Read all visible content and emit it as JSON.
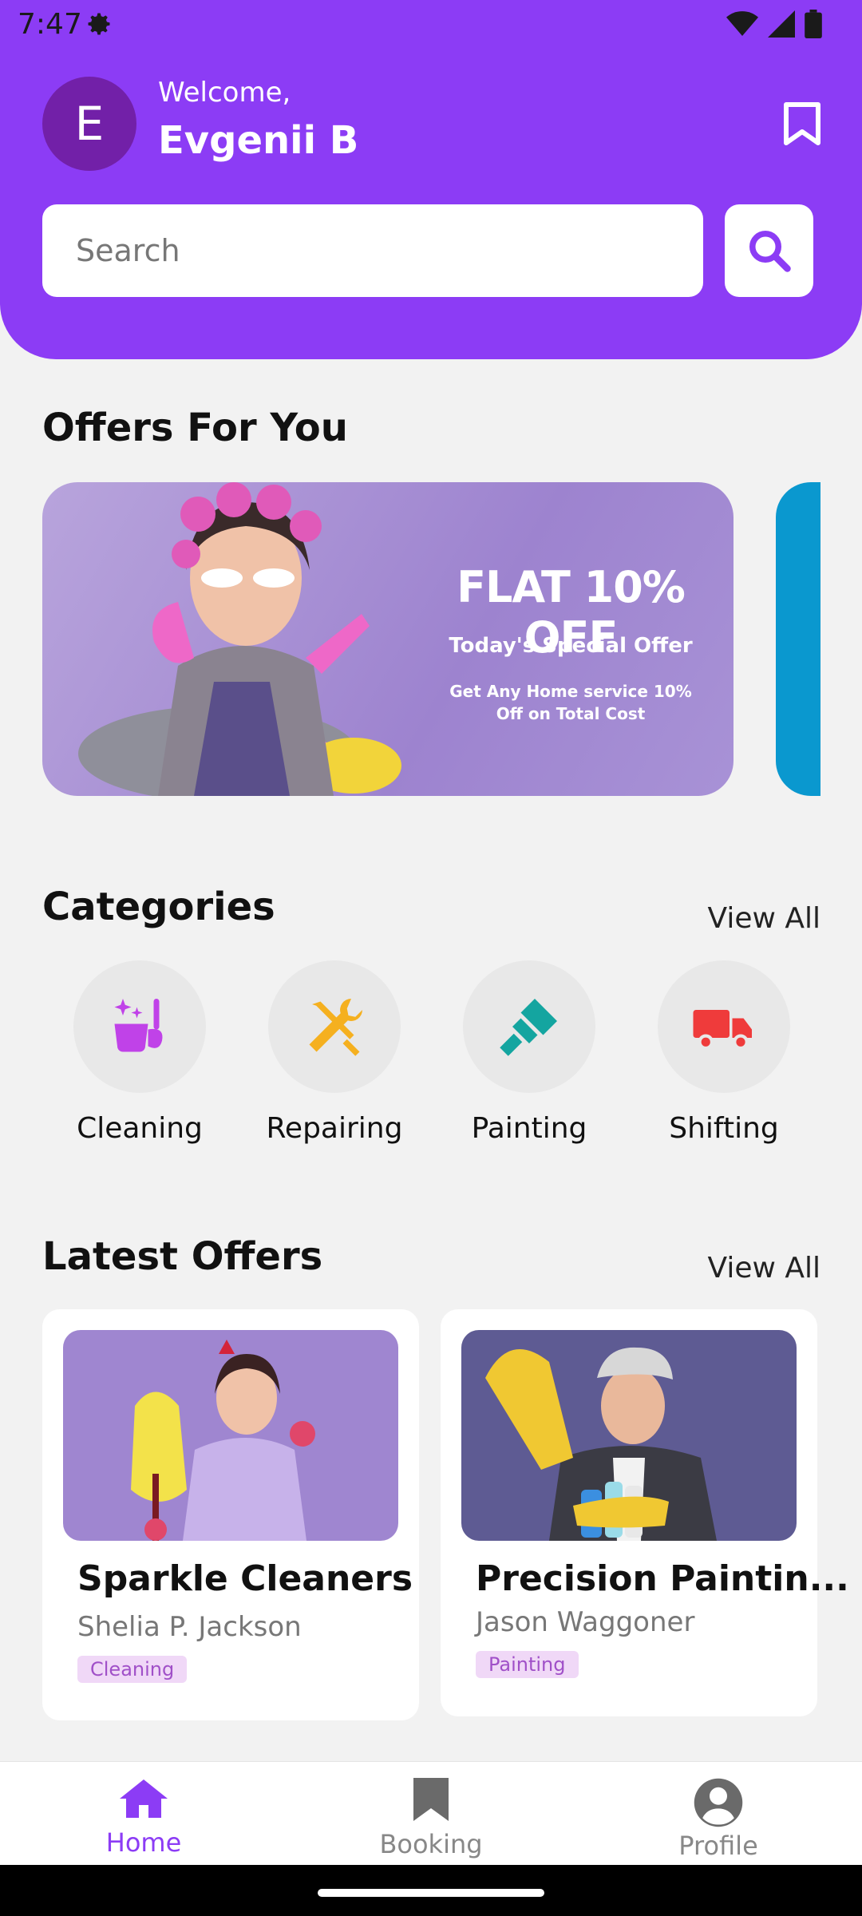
{
  "status_bar": {
    "time": "7:47"
  },
  "header": {
    "avatar_initial": "E",
    "welcome": "Welcome,",
    "user_name": "Evgenii B",
    "bg_color": "#8c3cf5"
  },
  "search": {
    "placeholder": "Search"
  },
  "offers": {
    "title": "Offers For You",
    "banner": {
      "headline": "FLAT 10% OFF",
      "subhead": "Today's Special Offer",
      "description": "Get Any Home service 10% Off on Total Cost"
    }
  },
  "categories": {
    "title": "Categories",
    "view_all": "View All",
    "items": [
      {
        "label": "Cleaning",
        "icon": "cleaning-icon",
        "color": "#c042e8"
      },
      {
        "label": "Repairing",
        "icon": "tools-icon",
        "color": "#f5b01f"
      },
      {
        "label": "Painting",
        "icon": "paint-brush-icon",
        "color": "#14a5a0"
      },
      {
        "label": "Shifting",
        "icon": "truck-icon",
        "color": "#ef3b3b"
      }
    ]
  },
  "latest_offers": {
    "title": "Latest Offers",
    "view_all": "View All",
    "cards": [
      {
        "title": "Sparkle Cleaners",
        "provider": "Shelia P. Jackson",
        "tag": "Cleaning"
      },
      {
        "title": "Precision Paintin...",
        "provider": "Jason Waggoner",
        "tag": "Painting"
      }
    ]
  },
  "bottom_nav": {
    "active_color": "#8c3cf5",
    "items": [
      {
        "label": "Home",
        "icon": "home-icon",
        "active": true
      },
      {
        "label": "Booking",
        "icon": "bookmark-icon",
        "active": false
      },
      {
        "label": "Profile",
        "icon": "profile-icon",
        "active": false
      }
    ]
  }
}
